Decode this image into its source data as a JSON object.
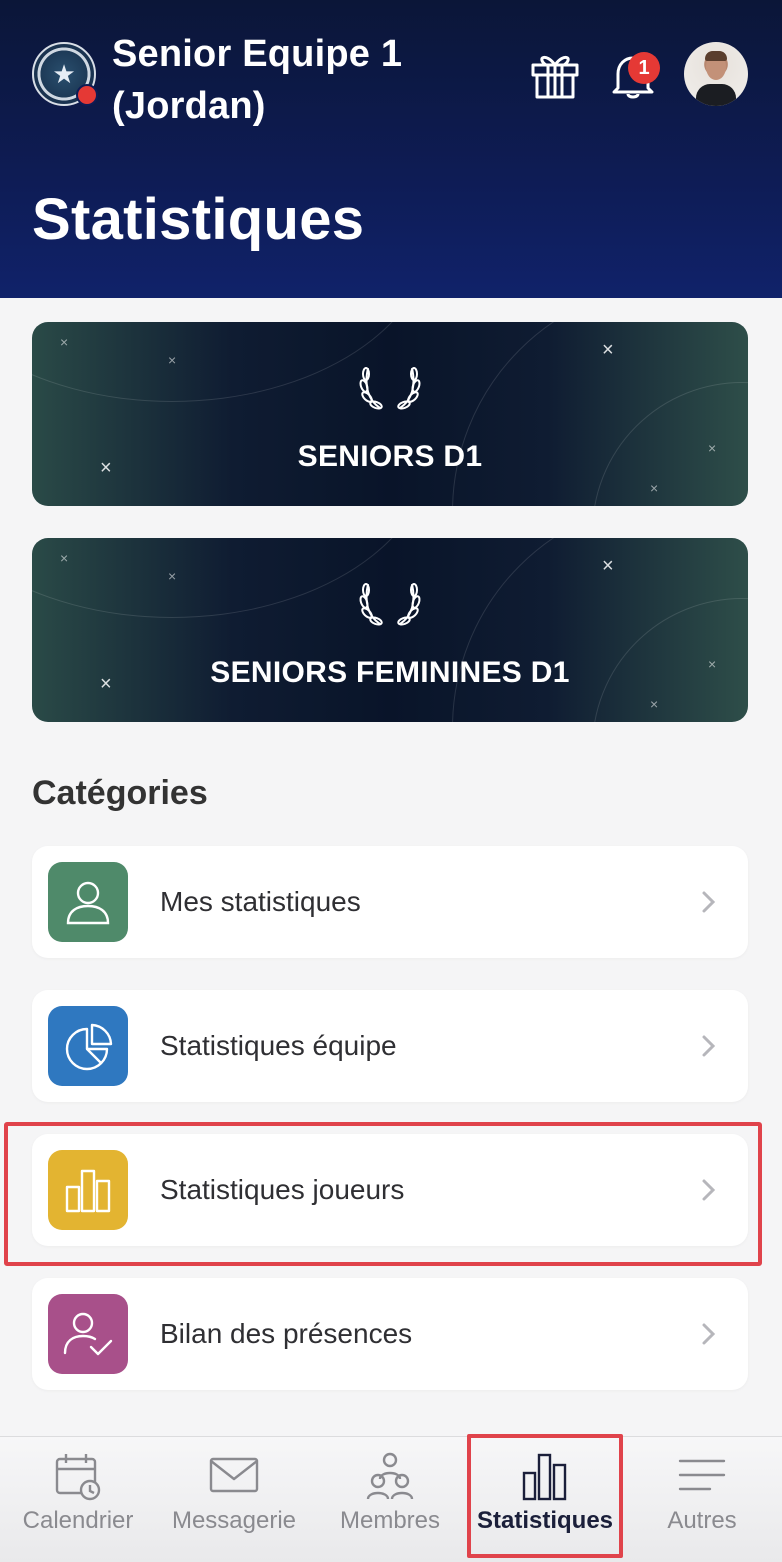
{
  "header": {
    "team_name": "Senior Equipe 1 (Jordan)",
    "notification_count": "1",
    "page_title": "Statistiques"
  },
  "competitions": [
    {
      "label": "SENIORS D1"
    },
    {
      "label": "SENIORS FEMININES D1"
    }
  ],
  "categories": {
    "title": "Catégories",
    "items": [
      {
        "label": "Mes statistiques",
        "icon": "person-icon",
        "color": "#4f8a6a"
      },
      {
        "label": "Statistiques équipe",
        "icon": "pie-chart-icon",
        "color": "#2f78c0"
      },
      {
        "label": "Statistiques joueurs",
        "icon": "bar-chart-icon",
        "color": "#e3b431"
      },
      {
        "label": "Bilan des présences",
        "icon": "person-check-icon",
        "color": "#a8508a"
      }
    ]
  },
  "bottom_nav": {
    "items": [
      {
        "label": "Calendrier",
        "icon": "calendar-icon"
      },
      {
        "label": "Messagerie",
        "icon": "mail-icon"
      },
      {
        "label": "Membres",
        "icon": "members-icon"
      },
      {
        "label": "Statistiques",
        "icon": "stats-icon",
        "active": true
      },
      {
        "label": "Autres",
        "icon": "menu-icon"
      }
    ]
  },
  "colors": {
    "header_bg": "#0e1c55",
    "highlight": "#e0434b",
    "badge": "#e53935"
  }
}
